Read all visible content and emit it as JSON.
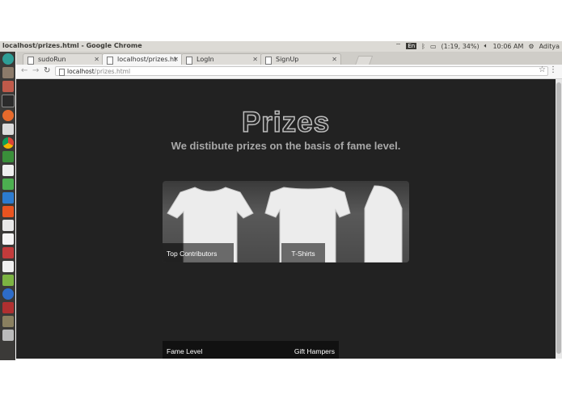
{
  "system": {
    "window_title": "localhost/prizes.html - Google Chrome",
    "keyboard": "En",
    "battery": "(1:19, 34%)",
    "clock": "10:06 AM",
    "user": "Aditya"
  },
  "launcher": {
    "icons": [
      "dash-icon",
      "files-icon",
      "archive-icon",
      "terminal-icon",
      "firefox-icon",
      "editor-icon",
      "chrome-icon",
      "spreadsheet-icon",
      "document-icon",
      "sheets-icon",
      "writer-icon",
      "ubuntu-software-icon",
      "doc-icon",
      "amazon-icon",
      "settings-icon",
      "mail-icon",
      "android-icon",
      "bluetooth-icon",
      "media-icon",
      "disk-icon",
      "trash-icon"
    ]
  },
  "browser": {
    "tabs": [
      {
        "label": "sudoRun",
        "active": false
      },
      {
        "label": "localhost/prizes.ht",
        "active": true
      },
      {
        "label": "LogIn",
        "active": false
      },
      {
        "label": "SignUp",
        "active": false
      }
    ],
    "url_host": "localhost",
    "url_path": "/prizes.html"
  },
  "page": {
    "heading": "Prizes",
    "subtitle": "We distibute prizes on the basis of fame level.",
    "card1": {
      "left_caption": "Top Contributors",
      "right_caption": "T-Shirts"
    },
    "card2": {
      "left_caption": "Fame Level",
      "right_caption": "Gift Hampers"
    }
  },
  "colors": {
    "page_background": "#222222",
    "heading_outline": "#bdbdbd",
    "subtitle": "#a8a8a8"
  }
}
